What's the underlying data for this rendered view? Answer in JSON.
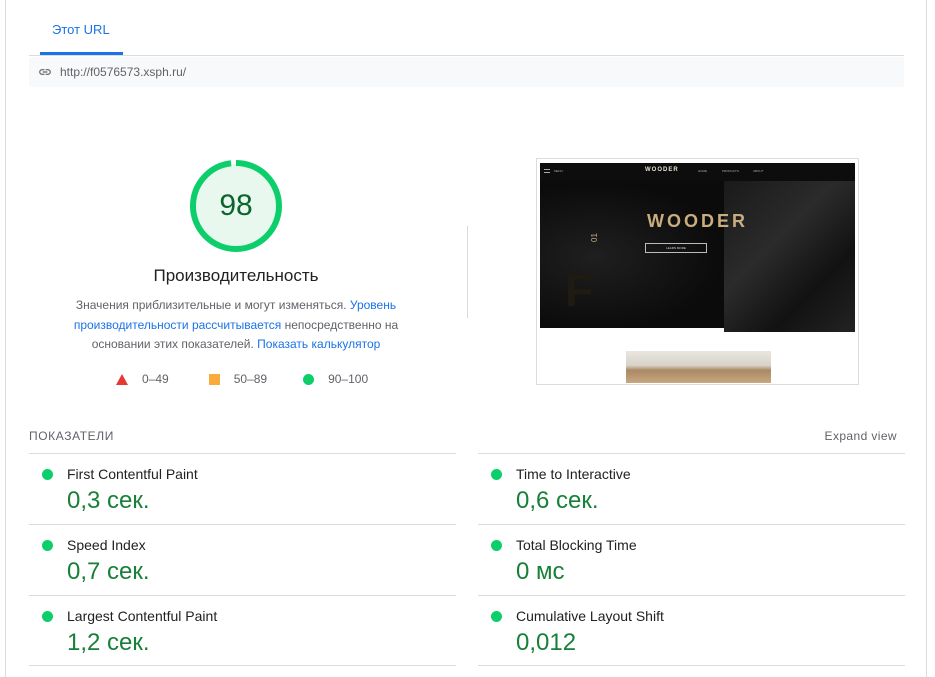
{
  "tab": {
    "label": "Этот URL"
  },
  "url": {
    "value": "http://f0576573.xsph.ru/"
  },
  "performance": {
    "score": "98",
    "score_value": 98,
    "title": "Производительность",
    "desc_part1": "Значения приблизительные и могут изменяться. ",
    "desc_link1": "Уровень производительности рассчитывается",
    "desc_part2": " непосредственно на основании этих показателей. ",
    "desc_link2": "Показать калькулятор"
  },
  "legend": [
    {
      "label": "0–49",
      "color": "#e53935"
    },
    {
      "label": "50–89",
      "color": "#fbaa3c"
    },
    {
      "label": "90–100",
      "color": "#0cce6b"
    }
  ],
  "preview": {
    "brand_top": "WOODER",
    "hero_title": "WOODER",
    "button_label": "LEARN MORE",
    "nav": [
      "HOME",
      "PRODUCTS",
      "ABOUT"
    ],
    "menu": "MENU",
    "number": "01",
    "big_letter": "F"
  },
  "metrics_section": {
    "header": "ПОКАЗАТЕЛИ",
    "expand_label": "Expand view"
  },
  "metrics": [
    {
      "label": "First Contentful Paint",
      "value": "0,3 сек."
    },
    {
      "label": "Time to Interactive",
      "value": "0,6 сек."
    },
    {
      "label": "Speed Index",
      "value": "0,7 сек."
    },
    {
      "label": "Total Blocking Time",
      "value": "0 мс"
    },
    {
      "label": "Largest Contentful Paint",
      "value": "1,2 сек."
    },
    {
      "label": "Cumulative Layout Shift",
      "value": "0,012"
    }
  ],
  "colors": {
    "pass": "#0cce6b",
    "pass_text": "#188038",
    "link": "#1a73e8"
  }
}
